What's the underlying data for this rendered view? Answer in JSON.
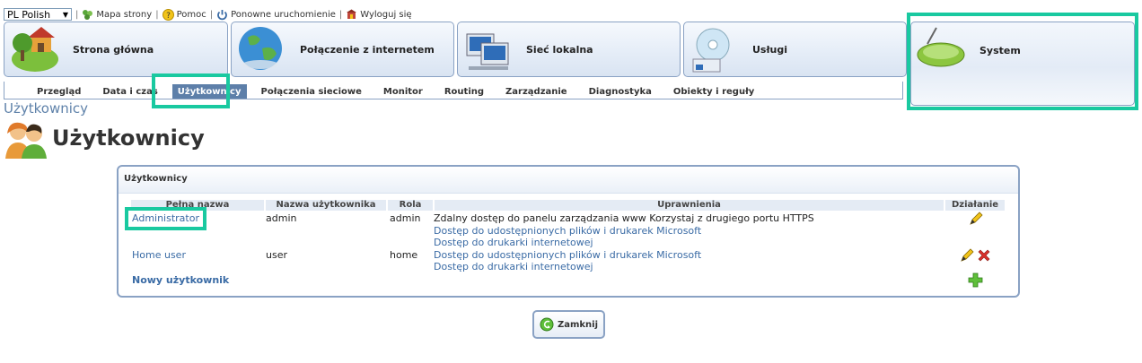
{
  "topbar": {
    "language": "PL Polish",
    "links": [
      {
        "icon": "sitemap-icon",
        "label": "Mapa strony"
      },
      {
        "icon": "help-icon",
        "label": "Pomoc"
      },
      {
        "icon": "power-icon",
        "label": "Ponowne uruchomienie"
      },
      {
        "icon": "logout-icon",
        "label": "Wyloguj się"
      }
    ]
  },
  "main_tabs": [
    {
      "icon": "home-icon",
      "label": "Strona główna"
    },
    {
      "icon": "globe-icon",
      "label": "Połączenie z internetem"
    },
    {
      "icon": "network-icon",
      "label": "Sieć lokalna"
    },
    {
      "icon": "services-icon",
      "label": "Usługi"
    },
    {
      "icon": "router-icon",
      "label": "System",
      "active": true
    }
  ],
  "sub_tabs": [
    "Przegląd",
    "Data i czas",
    "Użytkownicy",
    "Połączenia sieciowe",
    "Monitor",
    "Routing",
    "Zarządzanie",
    "Diagnostyka",
    "Obiekty i reguły"
  ],
  "sub_tab_active_index": 2,
  "breadcrumb": "Użytkownicy",
  "page_title": "Użytkownicy",
  "panel": {
    "title": "Użytkownicy",
    "columns": [
      "Pełna nazwa",
      "Nazwa użytkownika",
      "Rola",
      "Uprawnienia",
      "Działanie"
    ],
    "rows": [
      {
        "full_name": "Administrator",
        "username": "admin",
        "role": "admin",
        "permissions": [
          "Zdalny dostęp do panelu zarządzania www Korzystaj z drugiego portu HTTPS",
          "Dostęp do udostępnionych plików i drukarek Microsoft",
          "Dostęp do drukarki internetowej"
        ],
        "actions": [
          "edit"
        ]
      },
      {
        "full_name": "Home user",
        "username": "user",
        "role": "home",
        "permissions": [
          "Dostęp do udostępnionych plików i drukarek Microsoft",
          "Dostęp do drukarki internetowej"
        ],
        "actions": [
          "edit",
          "delete"
        ]
      }
    ],
    "new_user_label": "Nowy użytkownik"
  },
  "close_button": "Zamknij",
  "colors": {
    "highlight": "#19c9a0",
    "accent": "#5d7fa9",
    "link": "#3a6ba5",
    "border": "#8aa2c4"
  }
}
